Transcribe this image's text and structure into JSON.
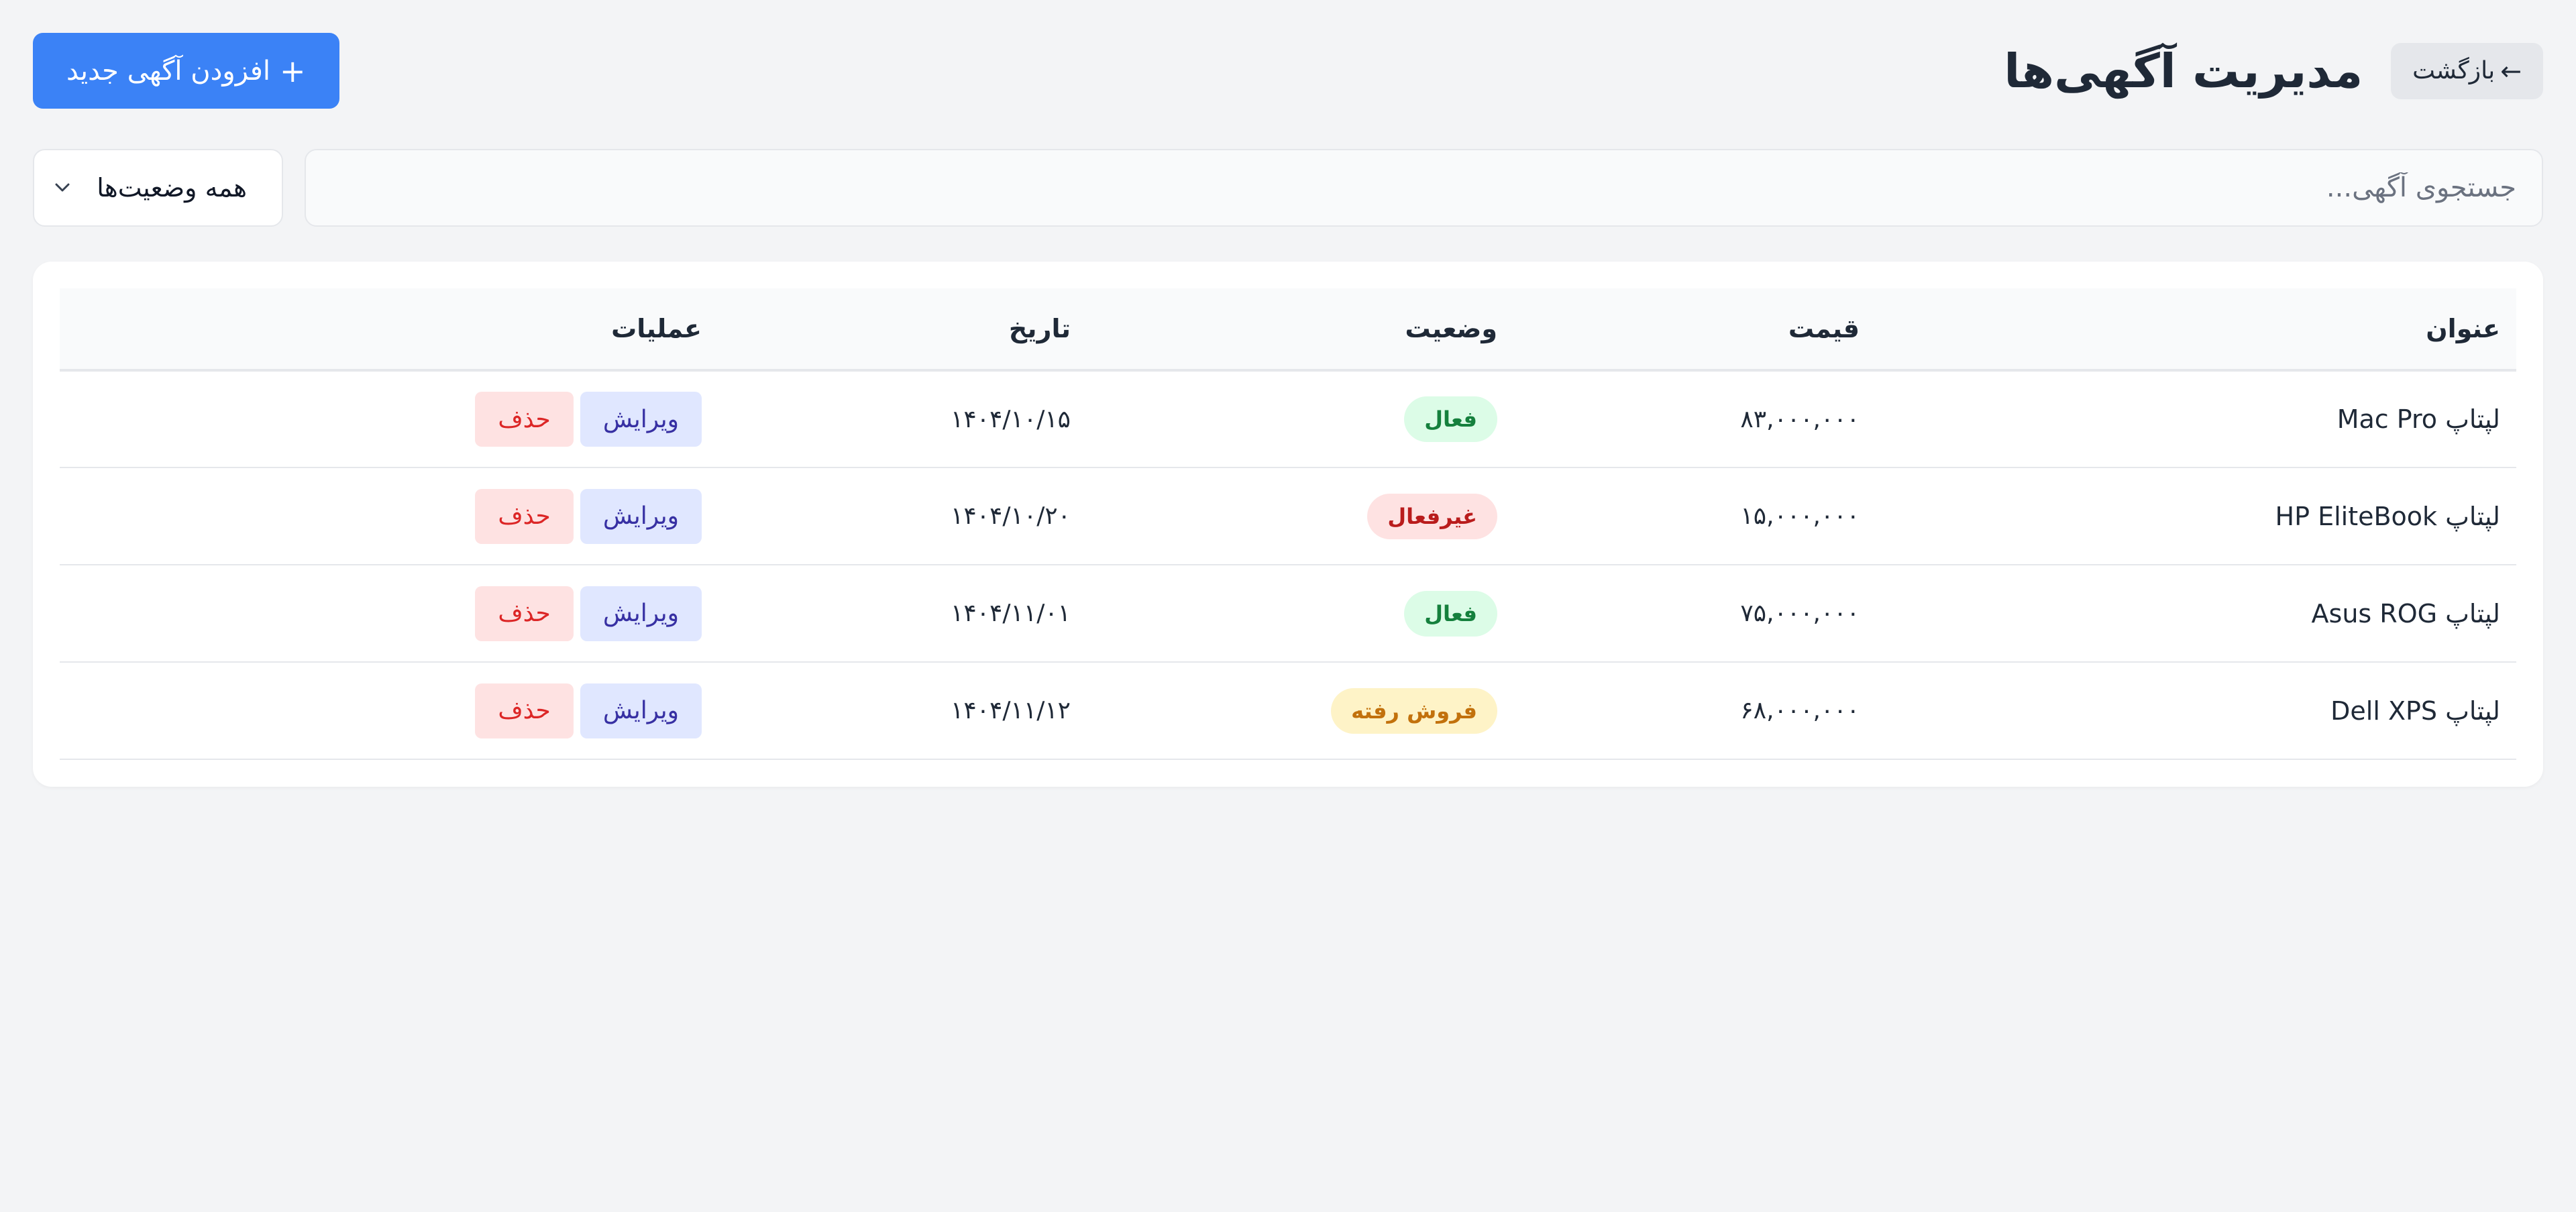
{
  "header": {
    "back_label": "بازگشت",
    "back_arrow": "←",
    "title": "مدیریت آگهی‌ها",
    "add_label": "افزودن آگهی جدید",
    "add_icon": "+"
  },
  "filters": {
    "search_placeholder": "جستجوی آگهی...",
    "status_selected": "همه وضعیت‌ها"
  },
  "table": {
    "headers": {
      "title": "عنوان",
      "price": "قیمت",
      "status": "وضعیت",
      "date": "تاریخ",
      "actions": "عملیات"
    },
    "rows": [
      {
        "title": "لپتاپ Mac Pro",
        "price": "۸۳,۰۰۰,۰۰۰",
        "status": "فعال",
        "status_kind": "active",
        "date": "۱۴۰۴/۱۰/۱۵",
        "edit": "ویرایش",
        "delete": "حذف"
      },
      {
        "title": "لپتاپ HP EliteBook",
        "price": "۱۵,۰۰۰,۰۰۰",
        "status": "غیرفعال",
        "status_kind": "inactive",
        "date": "۱۴۰۴/۱۰/۲۰",
        "edit": "ویرایش",
        "delete": "حذف"
      },
      {
        "title": "لپتاپ Asus ROG",
        "price": "۷۵,۰۰۰,۰۰۰",
        "status": "فعال",
        "status_kind": "active",
        "date": "۱۴۰۴/۱۱/۰۱",
        "edit": "ویرایش",
        "delete": "حذف"
      },
      {
        "title": "لپتاپ Dell XPS",
        "price": "۶۸,۰۰۰,۰۰۰",
        "status": "فروش رفته",
        "status_kind": "sold",
        "date": "۱۴۰۴/۱۱/۱۲",
        "edit": "ویرایش",
        "delete": "حذف"
      }
    ]
  },
  "colors": {
    "primary": "#3b82f6",
    "background": "#f3f4f6",
    "active": "#15803d",
    "inactive": "#b91c1c",
    "sold": "#c2710c"
  }
}
